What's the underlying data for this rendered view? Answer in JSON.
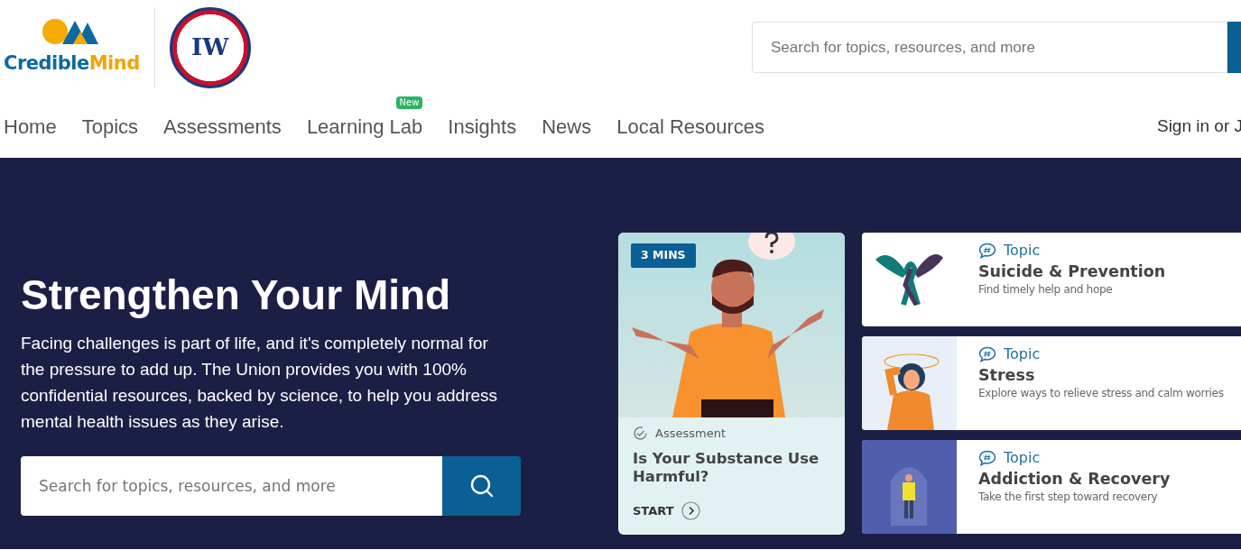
{
  "logo": {
    "name_part_1": "Credible",
    "name_part_2": "Mind"
  },
  "union_emblem": {
    "letters": "IW"
  },
  "header_search": {
    "placeholder": "Search for topics, resources, and more"
  },
  "nav": {
    "items": [
      {
        "label": "Home"
      },
      {
        "label": "Topics"
      },
      {
        "label": "Assessments"
      },
      {
        "label": "Learning Lab",
        "badge": "New"
      },
      {
        "label": "Insights"
      },
      {
        "label": "News"
      },
      {
        "label": "Local Resources"
      }
    ],
    "sign_in": "Sign in or J"
  },
  "hero": {
    "title": "Strengthen Your Mind",
    "text": "Facing challenges is part of life, and it's completely normal for the pressure to add up. The Union provides you with 100% confidential resources, backed by science, to help you address mental health issues as they arise.",
    "search": {
      "placeholder": "Search for topics, resources, and more"
    }
  },
  "assessment_card": {
    "duration": "3 MINS",
    "kind_label": "Assessment",
    "title": "Is Your Substance Use Harmful?",
    "action": "START"
  },
  "topic_cards": [
    {
      "kind": "ribbon",
      "label": "Topic",
      "title": "Suicide & Prevention",
      "description": "Find timely help and hope"
    },
    {
      "kind": "stress",
      "label": "Topic",
      "title": "Stress",
      "description": "Explore ways to relieve stress and calm worries"
    },
    {
      "kind": "dome",
      "label": "Topic",
      "title": "Addiction & Recovery",
      "description": "Take the first step toward recovery"
    }
  ]
}
